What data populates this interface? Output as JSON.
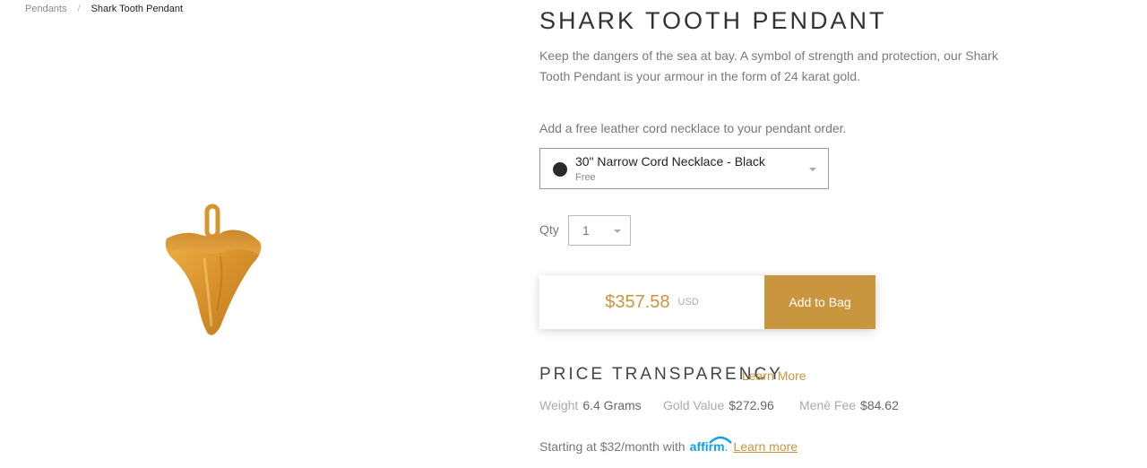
{
  "breadcrumb": {
    "parent": "Pendants",
    "separator": "/",
    "current": "Shark Tooth Pendant"
  },
  "product": {
    "title": "SHARK TOOTH PENDANT",
    "description": "Keep the dangers of the sea at bay. A symbol of strength and protection, our Shark Tooth Pendant is your armour in the form of 24 karat gold.",
    "image_icon": "shark-tooth-pendant"
  },
  "cord": {
    "prompt": "Add a free leather cord necklace to your pendant order.",
    "selected_name": "30\" Narrow Cord Necklace - Black",
    "selected_price": "Free",
    "swatch_color": "#2b2b2b"
  },
  "qty": {
    "label": "Qty",
    "value": "1"
  },
  "buy": {
    "price": "$357.58",
    "currency": "USD",
    "button_label": "Add to Bag"
  },
  "price_transparency": {
    "heading": "PRICE TRANSPARENCY",
    "learn_more": "Learn More",
    "weight_label": "Weight",
    "weight_value": "6.4 Grams",
    "gold_label": "Gold Value",
    "gold_value": "$272.96",
    "fee_label": "Menē Fee",
    "fee_value": "$84.62"
  },
  "affirm": {
    "prefix": "Starting at $32/month with",
    "logo_text": "affirm",
    "period": ".",
    "learn_more": "Learn more"
  },
  "colors": {
    "accent_gold": "#c9963f",
    "affirm_blue": "#0fa0ea"
  }
}
